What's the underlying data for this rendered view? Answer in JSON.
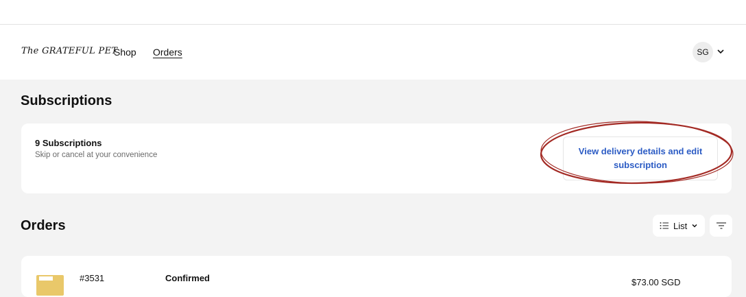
{
  "header": {
    "logo_text": "The GRATEFUL PET",
    "nav": {
      "shop": "Shop",
      "orders": "Orders"
    },
    "avatar_initials": "SG"
  },
  "subscriptions": {
    "heading": "Subscriptions",
    "count_label": "9 Subscriptions",
    "description": "Skip or cancel at your convenience",
    "button_label": "View delivery details and edit subscription",
    "annotation_color": "#a32a24"
  },
  "orders": {
    "heading": "Orders",
    "view_label": "List",
    "items": [
      {
        "number": "#3531",
        "status": "Confirmed",
        "total": "$73.00 SGD"
      }
    ]
  },
  "colors": {
    "link_blue": "#2b5bc4",
    "page_bg": "#f3f3f3"
  }
}
